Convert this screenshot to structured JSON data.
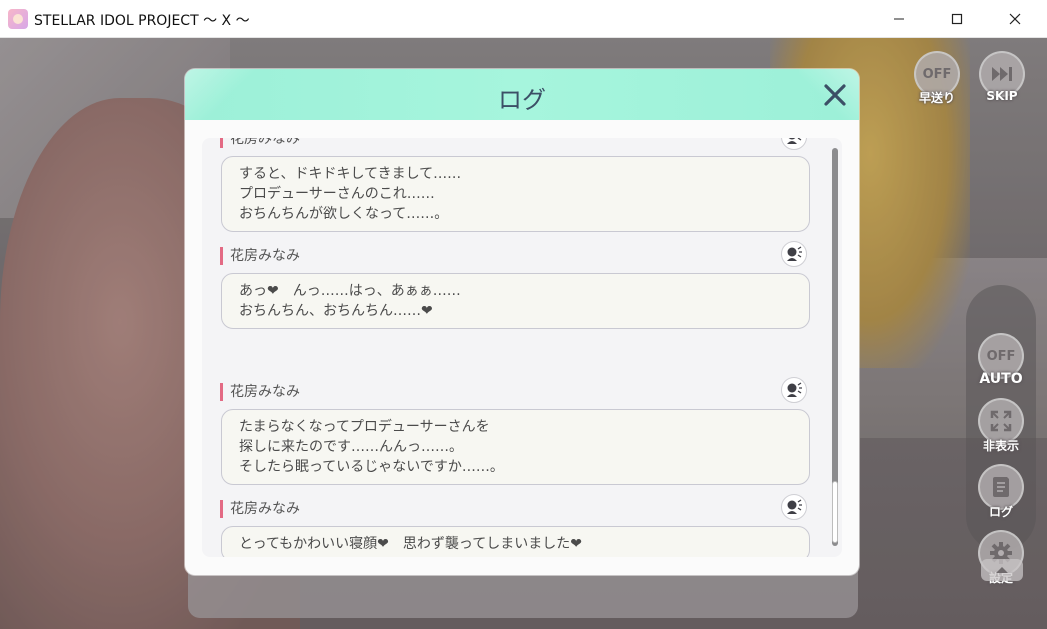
{
  "window": {
    "title": "STELLAR IDOL PROJECT ～ X ～"
  },
  "controls": {
    "fast_forward_state": "OFF",
    "fast_forward_label": "早送り",
    "skip_label": "SKIP",
    "auto_state": "OFF",
    "auto_label": "AUTO",
    "hide_label": "非表示",
    "log_label": "ログ",
    "settings_label": "設定"
  },
  "log_modal": {
    "title": "ログ",
    "entries": [
      {
        "speaker": "花房みなみ",
        "lines": [
          "すると、ドキドキしてきまして……",
          "プロデューサーさんのこれ……",
          "おちんちんが欲しくなって……。"
        ]
      },
      {
        "speaker": "花房みなみ",
        "lines": [
          "あっ❤　んっ……はっ、あぁぁ……",
          "おちんちん、おちんちん……❤"
        ]
      },
      {
        "speaker": "花房みなみ",
        "lines": [
          "たまらなくなってプロデューサーさんを",
          "探しに来たのです……んんっ……。",
          "そしたら眠っているじゃないですか……。"
        ]
      },
      {
        "speaker": "花房みなみ",
        "lines": [
          "とってもかわいい寝顔❤　思わず襲ってしまいました❤"
        ]
      }
    ]
  },
  "colors": {
    "header_accent": "#9cf0d8",
    "speaker_marker": "#e36a84",
    "title_text": "#3c4f66"
  }
}
